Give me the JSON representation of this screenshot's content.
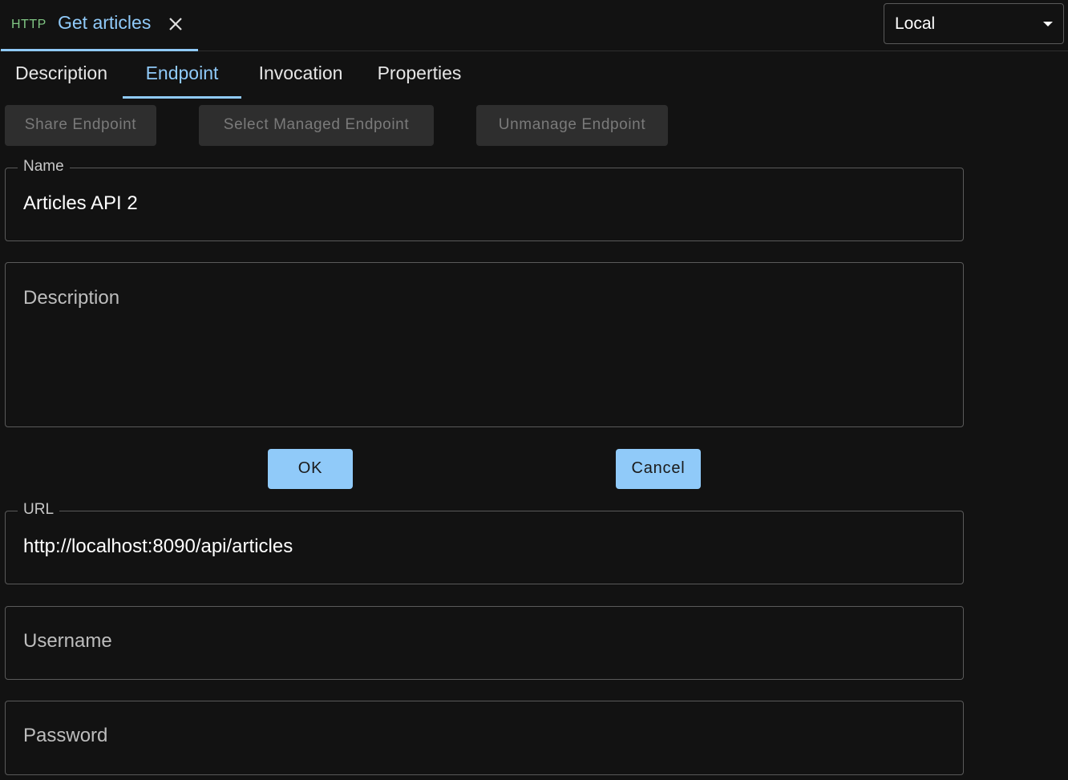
{
  "request_tab": {
    "method": "HTTP",
    "title": "Get articles",
    "close_icon": "close-icon"
  },
  "environment": {
    "selected": "Local"
  },
  "tabs": [
    {
      "label": "Description"
    },
    {
      "label": "Endpoint"
    },
    {
      "label": "Invocation"
    },
    {
      "label": "Properties"
    }
  ],
  "endpoint_actions": {
    "share": "Share Endpoint",
    "select_managed": "Select Managed Endpoint",
    "unmanage": "Unmanage Endpoint"
  },
  "form": {
    "name": {
      "label": "Name",
      "value": "Articles API 2"
    },
    "description": {
      "placeholder": "Description"
    },
    "ok_label": "OK",
    "cancel_label": "Cancel",
    "url": {
      "label": "URL",
      "value": "http://localhost:8090/api/articles"
    },
    "username": {
      "placeholder": "Username"
    },
    "password": {
      "placeholder": "Password"
    }
  },
  "colors": {
    "background": "#121212",
    "accent": "#90caf9",
    "method": "#81c784",
    "disabled_button": "#2e2e2e"
  }
}
